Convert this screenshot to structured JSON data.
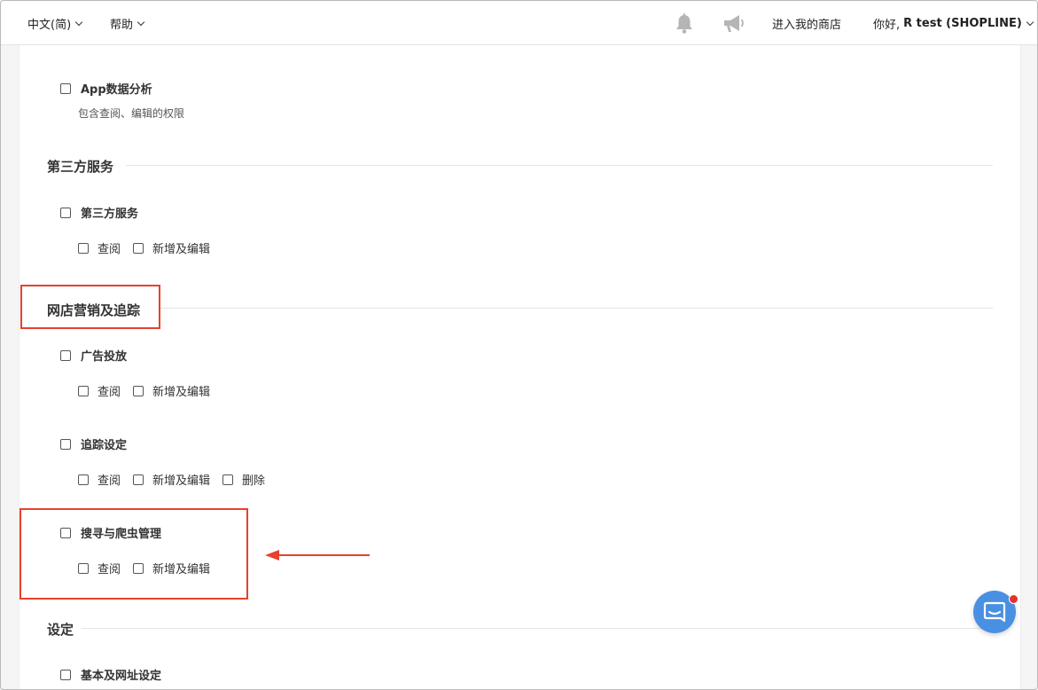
{
  "topbar": {
    "language": "中文(简)",
    "help": "帮助",
    "enter_store": "进入我的商店",
    "greeting": "你好,",
    "user_name": "R test (SHOPLINE)"
  },
  "sections": {
    "app_analytics": {
      "label": "App数据分析",
      "description": "包含查阅、编辑的权限"
    },
    "third_party": {
      "title": "第三方服务",
      "item_label": "第三方服务",
      "options": [
        "查阅",
        "新增及编辑"
      ]
    },
    "marketing": {
      "title": "网店营销及追踪",
      "ads": {
        "label": "广告投放",
        "options": [
          "查阅",
          "新增及编辑"
        ]
      },
      "tracking": {
        "label": "追踪设定",
        "options": [
          "查阅",
          "新增及编辑",
          "删除"
        ]
      },
      "seo": {
        "label": "搜寻与爬虫管理",
        "options": [
          "查阅",
          "新增及编辑"
        ]
      }
    },
    "settings": {
      "title": "设定",
      "basic": {
        "label": "基本及网址设定"
      }
    }
  },
  "colors": {
    "annotation": "#e8412c",
    "chat": "#4a90e2",
    "notification_dot": "#e8312c"
  },
  "icons": {
    "bell": "bell-icon",
    "megaphone": "megaphone-icon",
    "chat": "chat-icon"
  }
}
